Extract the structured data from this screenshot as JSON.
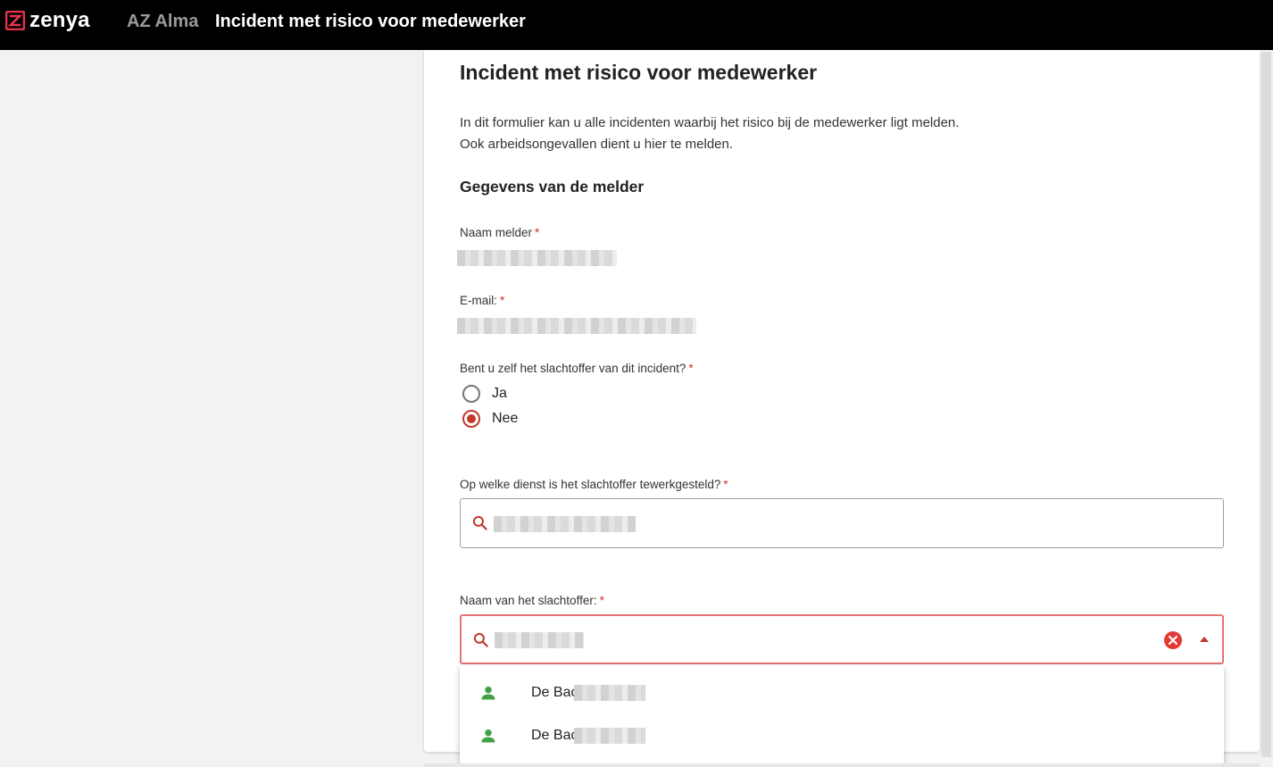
{
  "header": {
    "logo_text": "zenya",
    "organization": "AZ Alma",
    "title": "Incident met risico voor medewerker"
  },
  "form": {
    "title": "Incident met risico voor medewerker",
    "intro_line1": "In dit formulier kan u alle incidenten waarbij het risico bij de medewerker ligt melden.",
    "intro_line2": "Ook arbeidsongevallen dient u hier te melden.",
    "section_title": "Gegevens van de melder",
    "required_marker": "*",
    "fields": {
      "reporter_name": {
        "label": "Naam melder"
      },
      "email": {
        "label": "E-mail:"
      },
      "victim_self": {
        "label": "Bent u zelf het slachtoffer van dit incident?",
        "options": [
          "Ja",
          "Nee"
        ],
        "selected": "Nee"
      },
      "department": {
        "label": "Op welke dienst is het slachtoffer tewerkgesteld?"
      },
      "victim_name": {
        "label": "Naam van het slachtoffer:",
        "suggestions": [
          "De Bac",
          "De Bac"
        ]
      }
    }
  },
  "colors": {
    "accent": "#c0392b",
    "required": "#d32f2f",
    "active_border": "#e57373",
    "clear": "#e53935",
    "person": "#43a047",
    "brand": "#e8334a"
  }
}
